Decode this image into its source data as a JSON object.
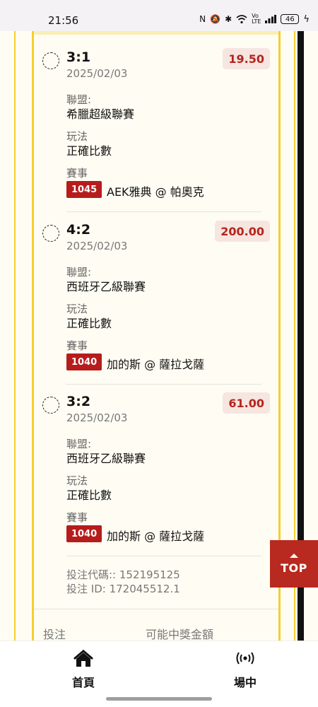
{
  "status_bar": {
    "time": "21:56",
    "battery": "46",
    "icons": [
      "nfc-icon",
      "mute-icon",
      "bluetooth-icon",
      "wifi-icon",
      "volte-icon",
      "signal-icon",
      "battery-icon",
      "charging-icon"
    ]
  },
  "labels": {
    "league": "聯盟:",
    "play_type": "玩法",
    "event": "賽事"
  },
  "bets": [
    {
      "score": "3:1",
      "date": "2025/02/03",
      "odds": "19.50",
      "league": "希臘超級聯賽",
      "play_type": "正確比數",
      "match_id": "1045",
      "match_name": "AEK雅典 @ 帕奧克"
    },
    {
      "score": "4:2",
      "date": "2025/02/03",
      "odds": "200.00",
      "league": "西班牙乙級聯賽",
      "play_type": "正確比數",
      "match_id": "1040",
      "match_name": "加的斯 @ 薩拉戈薩"
    },
    {
      "score": "3:2",
      "date": "2025/02/03",
      "odds": "61.00",
      "league": "西班牙乙級聯賽",
      "play_type": "正確比數",
      "match_id": "1040",
      "match_name": "加的斯 @ 薩拉戈薩"
    }
  ],
  "bet_code": "投注代碼:: 152195125",
  "bet_id": "投注 ID: 172045512.1",
  "footer": {
    "stake_label": "投注",
    "potential_win_label": "可能中獎金額"
  },
  "top_button": "TOP",
  "nav": {
    "home_label": "首頁",
    "live_label": "場中"
  },
  "colors": {
    "accent_red": "#b8291f",
    "odds_bg": "#f7e5e0",
    "frame_yellow": "#f5cf2e"
  }
}
